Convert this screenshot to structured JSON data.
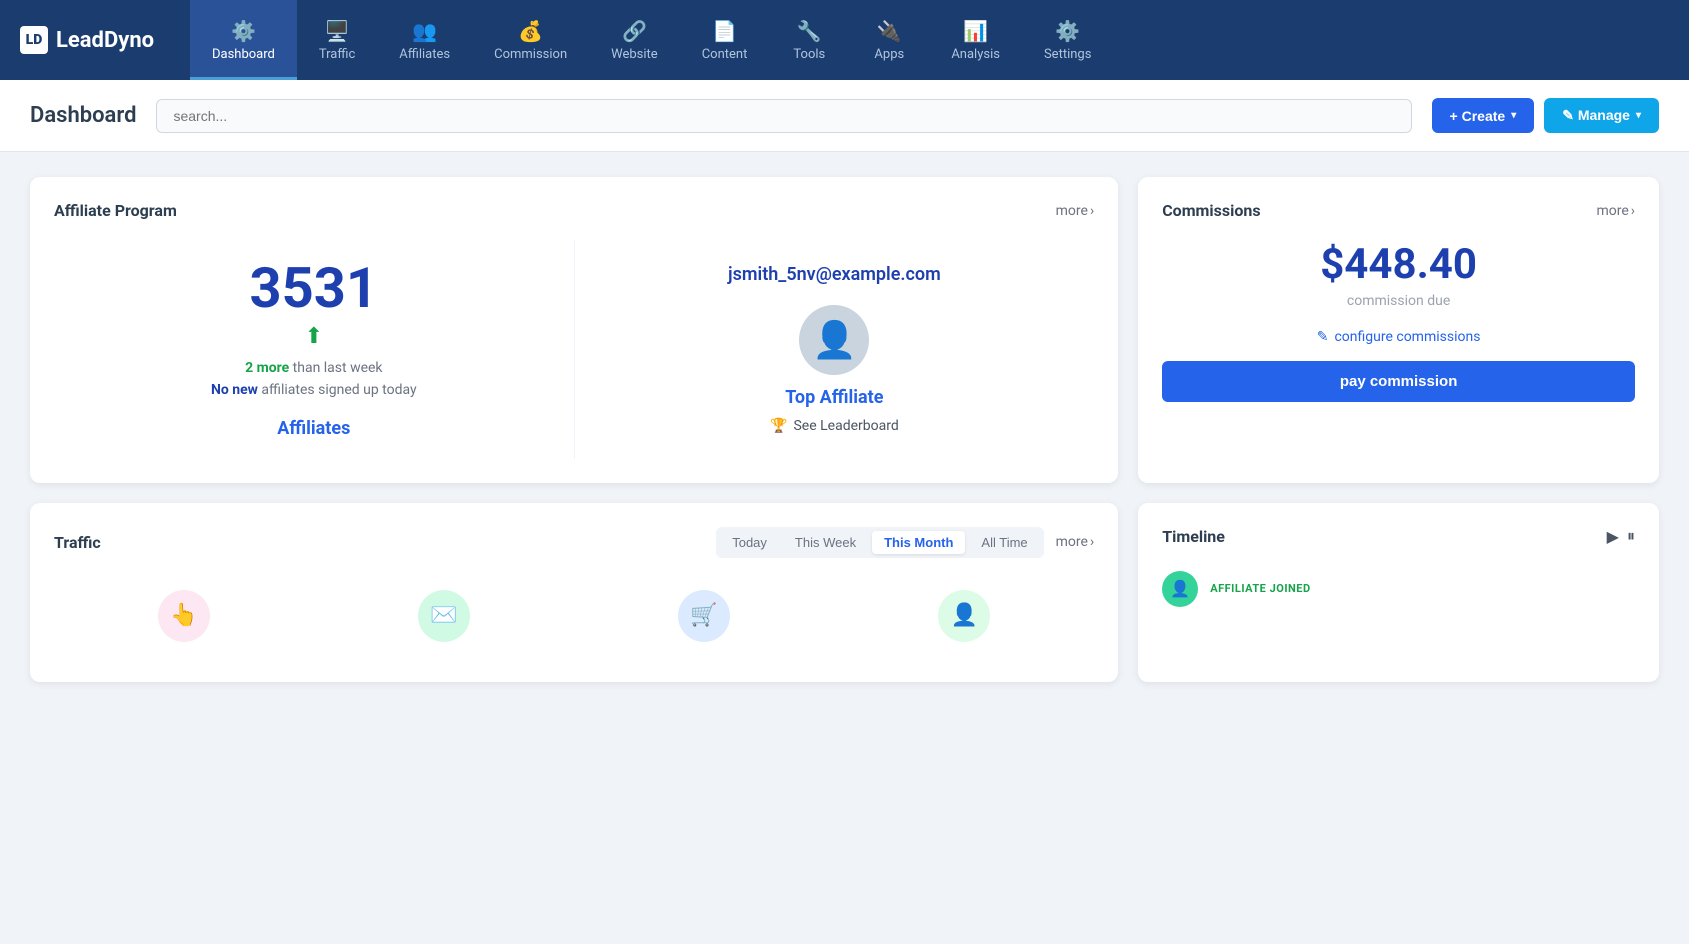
{
  "brand": {
    "logo_letter": "LD",
    "name": "LeadDyno"
  },
  "nav": {
    "items": [
      {
        "id": "dashboard",
        "label": "Dashboard",
        "icon": "⚙",
        "active": true
      },
      {
        "id": "traffic",
        "label": "Traffic",
        "icon": "🖥",
        "active": false
      },
      {
        "id": "affiliates",
        "label": "Affiliates",
        "icon": "👥",
        "active": false
      },
      {
        "id": "commission",
        "label": "Commission",
        "icon": "💰",
        "active": false
      },
      {
        "id": "website",
        "label": "Website",
        "icon": "🔗",
        "active": false
      },
      {
        "id": "content",
        "label": "Content",
        "icon": "📄",
        "active": false
      },
      {
        "id": "tools",
        "label": "Tools",
        "icon": "🔧",
        "active": false
      },
      {
        "id": "apps",
        "label": "Apps",
        "icon": "🔌",
        "active": false
      },
      {
        "id": "analysis",
        "label": "Analysis",
        "icon": "📊",
        "active": false
      },
      {
        "id": "settings",
        "label": "Settings",
        "icon": "⚙",
        "active": false
      }
    ]
  },
  "header": {
    "title": "Dashboard",
    "search_placeholder": "search...",
    "create_label": "+ Create",
    "manage_label": "✎ Manage"
  },
  "affiliate_program": {
    "title": "Affiliate Program",
    "more_label": "more",
    "count": "3531",
    "trend_more": "2 more",
    "trend_text": " than last week",
    "no_new_label": "No new",
    "no_new_text": " affiliates signed up today",
    "affiliates_link": "Affiliates",
    "top_email": "jsmith_5nv@example.com",
    "top_affiliate_label": "Top Affiliate",
    "see_leaderboard": "See Leaderboard"
  },
  "commissions": {
    "title": "Commissions",
    "more_label": "more",
    "amount": "$448.40",
    "due_label": "commission due",
    "configure_label": "configure commissions",
    "pay_label": "pay commission"
  },
  "traffic": {
    "title": "Traffic",
    "more_label": "more",
    "filters": [
      {
        "id": "today",
        "label": "Today",
        "active": false
      },
      {
        "id": "this-week",
        "label": "This Week",
        "active": false
      },
      {
        "id": "this-month",
        "label": "This Month",
        "active": true
      },
      {
        "id": "all-time",
        "label": "All Time",
        "active": false
      }
    ],
    "icons": [
      {
        "id": "cursor",
        "icon": "👆",
        "color": "pink"
      },
      {
        "id": "email",
        "icon": "✉",
        "color": "teal"
      },
      {
        "id": "cart",
        "icon": "🛒",
        "color": "blue"
      },
      {
        "id": "person",
        "icon": "👤",
        "color": "green"
      }
    ]
  },
  "timeline": {
    "title": "Timeline",
    "item": {
      "type": "AFFILIATE JOINED",
      "avatar_color": "#34d399"
    }
  }
}
